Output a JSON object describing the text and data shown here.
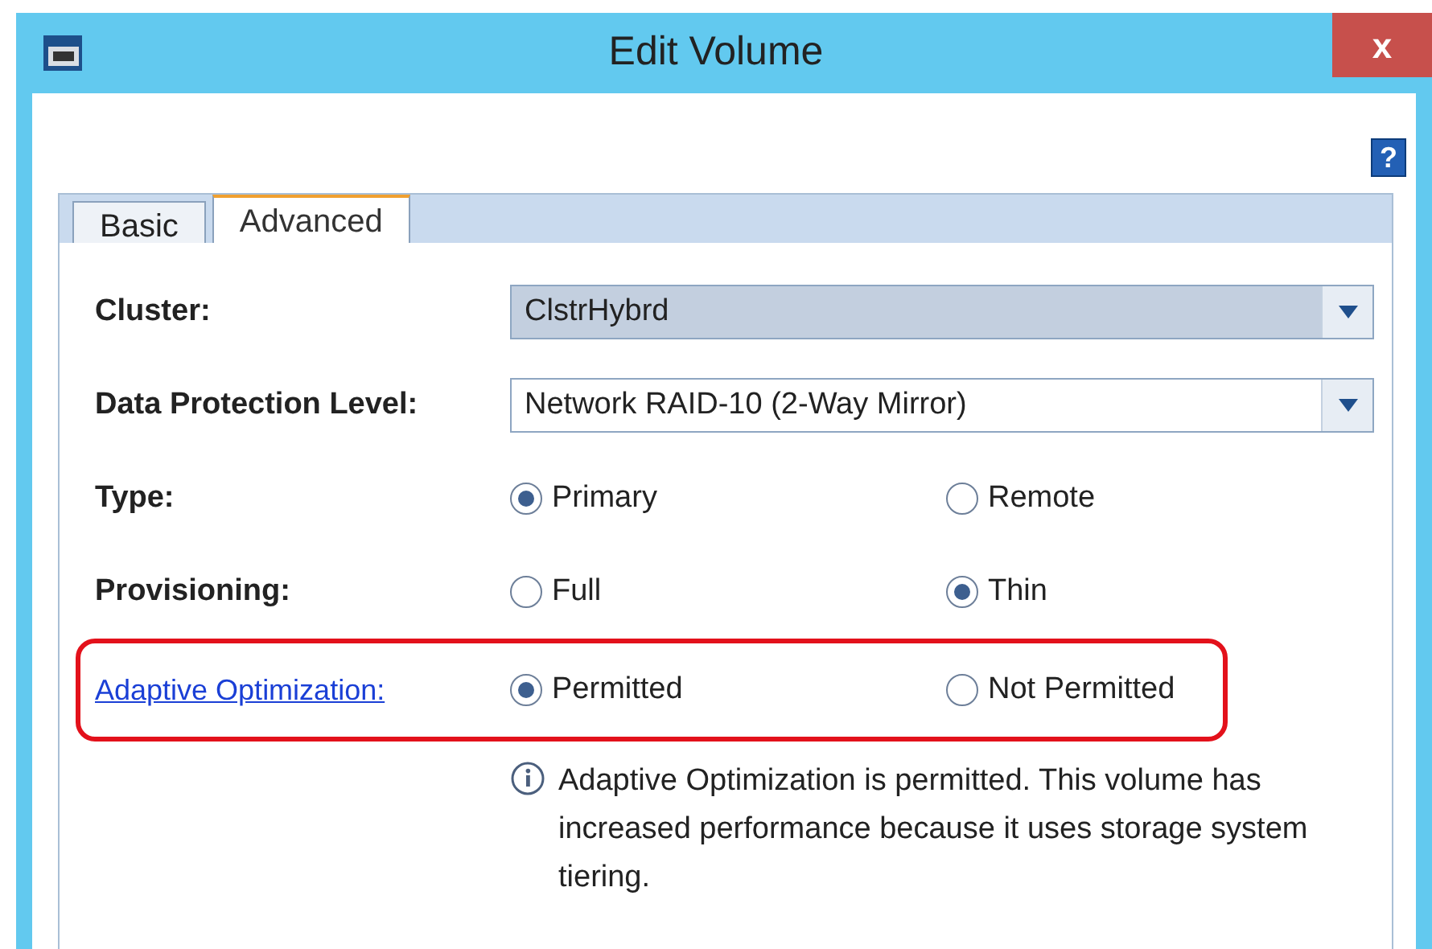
{
  "window": {
    "title": "Edit Volume",
    "close": "x",
    "help": "?"
  },
  "tabs": [
    {
      "label": "Basic",
      "selected": false
    },
    {
      "label": "Advanced",
      "selected": true
    }
  ],
  "fields": [
    {
      "kind": "dropdown",
      "label": "Cluster:",
      "value": "ClstrHybrd",
      "highlighted_value": true,
      "link": false,
      "highlighted": false
    },
    {
      "kind": "dropdown",
      "label": "Data Protection Level:",
      "value": "Network RAID-10 (2-Way Mirror)",
      "highlighted_value": false,
      "link": false,
      "highlighted": false
    },
    {
      "kind": "radio",
      "label": "Type:",
      "link": false,
      "highlighted": false,
      "options": [
        {
          "label": "Primary",
          "selected": true
        },
        {
          "label": "Remote",
          "selected": false
        }
      ]
    },
    {
      "kind": "radio",
      "label": "Provisioning:",
      "link": false,
      "highlighted": false,
      "options": [
        {
          "label": "Full",
          "selected": false
        },
        {
          "label": "Thin",
          "selected": true
        }
      ]
    },
    {
      "kind": "radio",
      "label": "Adaptive Optimization:",
      "link": true,
      "highlighted": true,
      "options": [
        {
          "label": "Permitted",
          "selected": true
        },
        {
          "label": "Not Permitted",
          "selected": false
        }
      ]
    }
  ],
  "info": "Adaptive Optimization is permitted. This volume has increased performance because it uses storage system tiering."
}
